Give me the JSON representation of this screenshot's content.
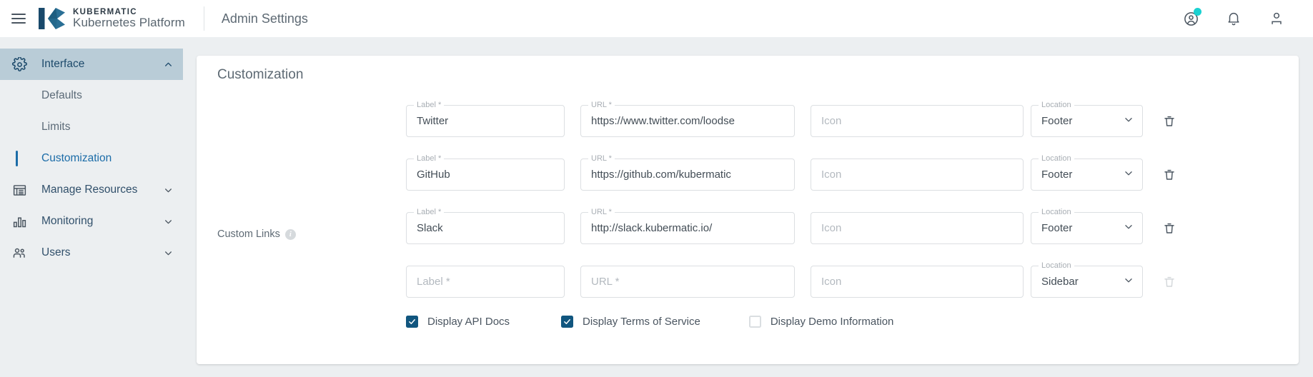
{
  "topbar": {
    "menu_icon": "hamburger-menu-icon",
    "brand_line1": "KUBERMATIC",
    "brand_line2": "Kubernetes Platform",
    "page_context": "Admin Settings",
    "actions": [
      {
        "icon": "help-support-icon",
        "has_badge": true
      },
      {
        "icon": "notification-bell-icon",
        "has_badge": false
      },
      {
        "icon": "user-account-icon",
        "has_badge": false
      }
    ]
  },
  "sidebar": {
    "groups": [
      {
        "label": "Interface",
        "icon": "gear-icon",
        "active": true,
        "expanded": true,
        "chevron": "chevron-up-icon",
        "children": [
          {
            "label": "Defaults",
            "selected": false
          },
          {
            "label": "Limits",
            "selected": false
          },
          {
            "label": "Customization",
            "selected": true
          }
        ]
      },
      {
        "label": "Manage Resources",
        "icon": "list-table-icon",
        "active": false,
        "expanded": false,
        "chevron": "chevron-down-icon",
        "children": []
      },
      {
        "label": "Monitoring",
        "icon": "bar-chart-icon",
        "active": false,
        "expanded": false,
        "chevron": "chevron-down-icon",
        "children": []
      },
      {
        "label": "Users",
        "icon": "users-group-icon",
        "active": false,
        "expanded": false,
        "chevron": "chevron-down-icon",
        "children": []
      }
    ]
  },
  "card": {
    "title": "Customization",
    "custom_links": {
      "label": "Custom Links",
      "info_icon": "info-icon",
      "info_glyph": "i",
      "column_labels": {
        "label": "Label *",
        "url": "URL *",
        "icon": "Icon",
        "location": "Location"
      },
      "placeholders": {
        "label": "Label *",
        "url": "URL *",
        "icon": "Icon"
      },
      "rows": [
        {
          "label": "Twitter",
          "url": "https://www.twitter.com/loodse",
          "icon": "",
          "location": "Footer",
          "delete_enabled": true,
          "delete_icon": "trash-delete-icon",
          "chevron": "chevron-down-icon"
        },
        {
          "label": "GitHub",
          "url": "https://github.com/kubermatic",
          "icon": "",
          "location": "Footer",
          "delete_enabled": true,
          "delete_icon": "trash-delete-icon",
          "chevron": "chevron-down-icon"
        },
        {
          "label": "Slack",
          "url": "http://slack.kubermatic.io/",
          "icon": "",
          "location": "Footer",
          "delete_enabled": true,
          "delete_icon": "trash-delete-icon",
          "chevron": "chevron-down-icon"
        },
        {
          "label": "",
          "url": "",
          "icon": "",
          "location": "Sidebar",
          "delete_enabled": false,
          "delete_icon": "trash-delete-icon",
          "chevron": "chevron-down-icon"
        }
      ]
    },
    "checkboxes": [
      {
        "label": "Display API Docs",
        "checked": true
      },
      {
        "label": "Display Terms of Service",
        "checked": true
      },
      {
        "label": "Display Demo Information",
        "checked": false
      }
    ]
  },
  "colors": {
    "page_background": "#eceff1",
    "card_background": "#ffffff",
    "brand_dark": "#19496b",
    "brand_mid": "#2a6f95",
    "accent_link": "#1b6ca8",
    "sidebar_active": "#b9ccd7",
    "checkbox_checked": "#11567f",
    "badge_dot": "#1ad1d1",
    "text_primary": "#4a5560",
    "text_muted": "#5e6a74",
    "field_border": "#dcdfe2"
  }
}
